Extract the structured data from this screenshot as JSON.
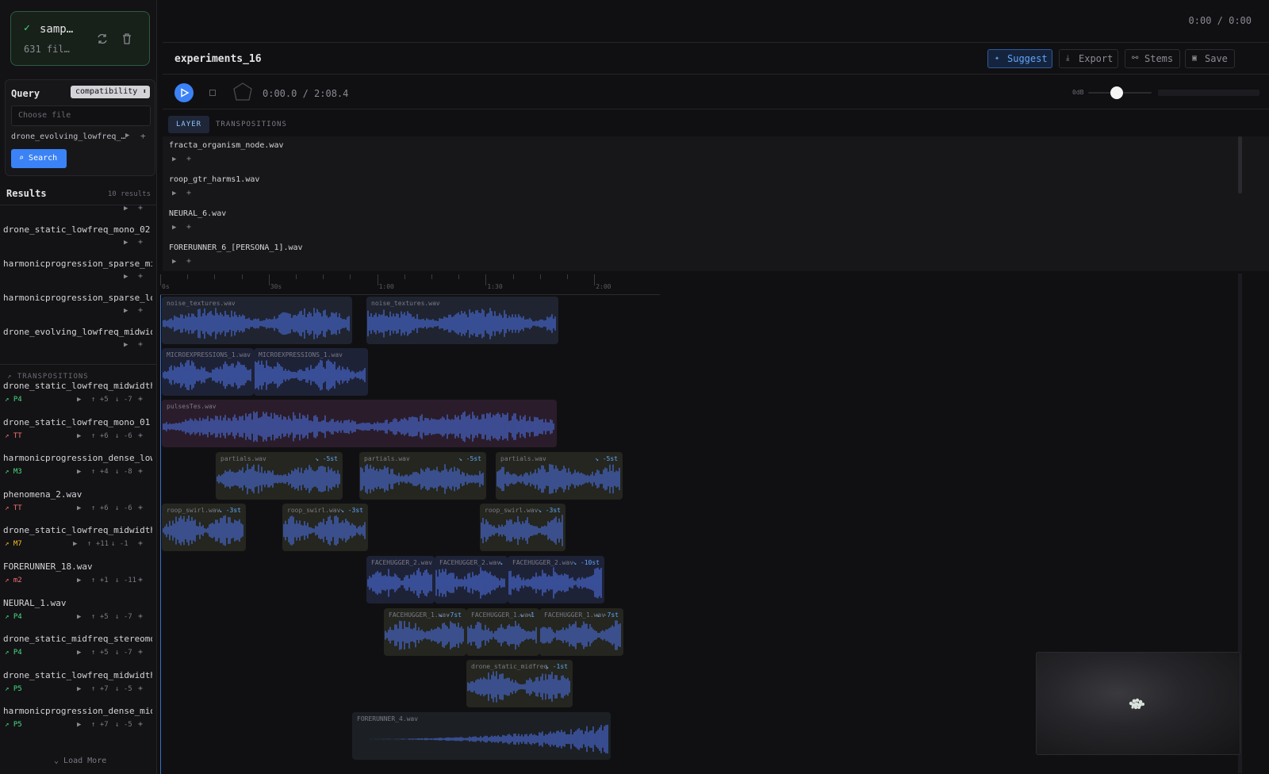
{
  "collection": {
    "name": "samp…",
    "count": "631 fil…"
  },
  "query": {
    "label": "Query",
    "mode": "compatibility",
    "file_placeholder": "Choose file",
    "current_file": "drone_evolving_lowfreq_…",
    "search_label": "Search"
  },
  "results": {
    "title": "Results",
    "count": "10 results",
    "items": [
      "drone_static_lowfreq_mono_02.…",
      "harmonicprogression_sparse_mi…",
      "harmonicprogression_sparse_lo…",
      "drone_evolving_lowfreq_midwid…"
    ]
  },
  "transpositions": {
    "title": "TRANSPOSITIONS",
    "items": [
      {
        "name": "drone_static_lowfreq_midwidth…",
        "interval": "P4",
        "color": "#4ade80",
        "up": "+5",
        "down": "-7"
      },
      {
        "name": "drone_static_lowfreq_mono_01.…",
        "interval": "TT",
        "color": "#f87171",
        "up": "+6",
        "down": "-6"
      },
      {
        "name": "harmonicprogression_dense_low…",
        "interval": "M3",
        "color": "#4ade80",
        "up": "+4",
        "down": "-8"
      },
      {
        "name": "phenomena_2.wav",
        "interval": "TT",
        "color": "#f87171",
        "up": "+6",
        "down": "-6"
      },
      {
        "name": "drone_static_lowfreq_midwidth…",
        "interval": "M7",
        "color": "#fbbf24",
        "up": "+11",
        "down": "-1"
      },
      {
        "name": "FORERUNNER_18.wav",
        "interval": "m2",
        "color": "#f87171",
        "up": "+1",
        "down": "-11"
      },
      {
        "name": "NEURAL_1.wav",
        "interval": "P4",
        "color": "#4ade80",
        "up": "+5",
        "down": "-7"
      },
      {
        "name": "drone_static_midfreq_stereomo…",
        "interval": "P4",
        "color": "#4ade80",
        "up": "+5",
        "down": "-7"
      },
      {
        "name": "drone_static_lowfreq_midwidth…",
        "interval": "P5",
        "color": "#4ade80",
        "up": "+7",
        "down": "-5"
      },
      {
        "name": "harmonicprogression_dense_mid…",
        "interval": "P5",
        "color": "#4ade80",
        "up": "+7",
        "down": "-5"
      }
    ],
    "load_more": "Load More"
  },
  "top": {
    "time": "0:00 / 0:00"
  },
  "project": {
    "title": "experiments_16"
  },
  "toolbar": {
    "suggest": "Suggest",
    "export": "Export",
    "stems": "Stems",
    "save": "Save"
  },
  "transport": {
    "time": "0:00.0 / 2:08.4",
    "volume_label": "0dB",
    "volume_level": 0.45
  },
  "tabs": {
    "layer": "LAYER",
    "transpositions": "TRANSPOSITIONS"
  },
  "layers": [
    "fracta_organism_node.wav",
    "roop_gtr_harms1.wav",
    "NEURAL_6.wav",
    "FORERUNNER_6_[PERSONA_1].wav"
  ],
  "ruler": [
    "0s",
    "30s",
    "1:00",
    "1:30",
    "2:00"
  ],
  "tracks": [
    {
      "clips": [
        {
          "label": "noise_textures.wav",
          "tag": ""
        },
        {
          "label": "noise_textures.wav",
          "tag": ""
        }
      ],
      "color": "#1f2430"
    },
    {
      "clips": [
        {
          "label": "MICROEXPRESSIONS_1.wav",
          "tag": ""
        },
        {
          "label": "MICROEXPRESSIONS_1.wav",
          "tag": ""
        }
      ],
      "color": "#1e2236"
    },
    {
      "clips": [
        {
          "label": "pulsesTes.wav",
          "tag": ""
        }
      ],
      "color": "#2a1c2a"
    },
    {
      "clips": [
        {
          "label": "partials.wav",
          "tag": "↘ -5st"
        },
        {
          "label": "partials.wav",
          "tag": "↘ -5st"
        },
        {
          "label": "partials.wav",
          "tag": "↘ -5st"
        }
      ],
      "color": "#24261f"
    },
    {
      "clips": [
        {
          "label": "roop_swirl.wav",
          "tag": "↘ -3st"
        },
        {
          "label": "roop_swirl.wav",
          "tag": "↘ -3st"
        },
        {
          "label": "roop_swirl.wav",
          "tag": "↘ -3st"
        }
      ],
      "color": "#24261f"
    },
    {
      "clips": [
        {
          "label": "FACEHUGGER_2.wav",
          "tag": ""
        },
        {
          "label": "FACEHUGGER_2.wav",
          "tag": "↘"
        },
        {
          "label": "FACEHUGGER_2.wav",
          "tag": "↘ -10st"
        }
      ],
      "color": "#1e2236"
    },
    {
      "clips": [
        {
          "label": "FACEHUGGER_1.wav",
          "tag": "↘ -7st"
        },
        {
          "label": "FACEHUGGER_1.wav",
          "tag": "↘ -1"
        },
        {
          "label": "FACEHUGGER_1.wav",
          "tag": "↘ -7st"
        }
      ],
      "color": "#24261f"
    },
    {
      "clips": [
        {
          "label": "drone_static_midfreq",
          "tag": "↘ -1st"
        }
      ],
      "color": "#24261f"
    },
    {
      "clips": [
        {
          "label": "FORERUNNER_4.wav",
          "tag": ""
        }
      ],
      "color": "#1c2024"
    }
  ],
  "colors": {
    "accent": "#3b82f6",
    "waveform": "#4a6bd6",
    "success": "#4ade80"
  }
}
